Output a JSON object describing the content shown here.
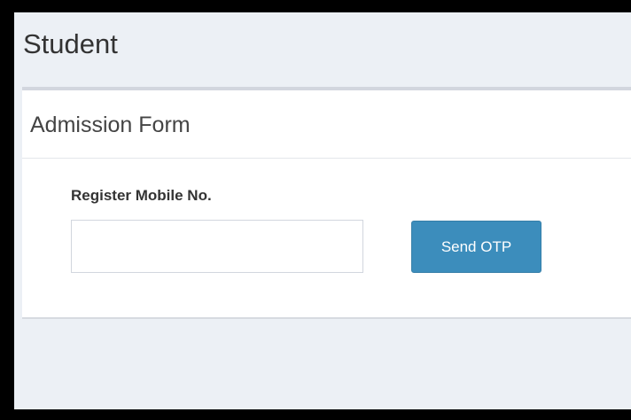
{
  "page": {
    "title": "Student"
  },
  "card": {
    "title": "Admission Form"
  },
  "form": {
    "mobile_label": "Register Mobile No.",
    "mobile_value": "",
    "mobile_placeholder": "",
    "send_otp_label": "Send OTP"
  },
  "colors": {
    "background": "#ecf0f5",
    "button": "#3c8dbc",
    "card": "#ffffff"
  }
}
